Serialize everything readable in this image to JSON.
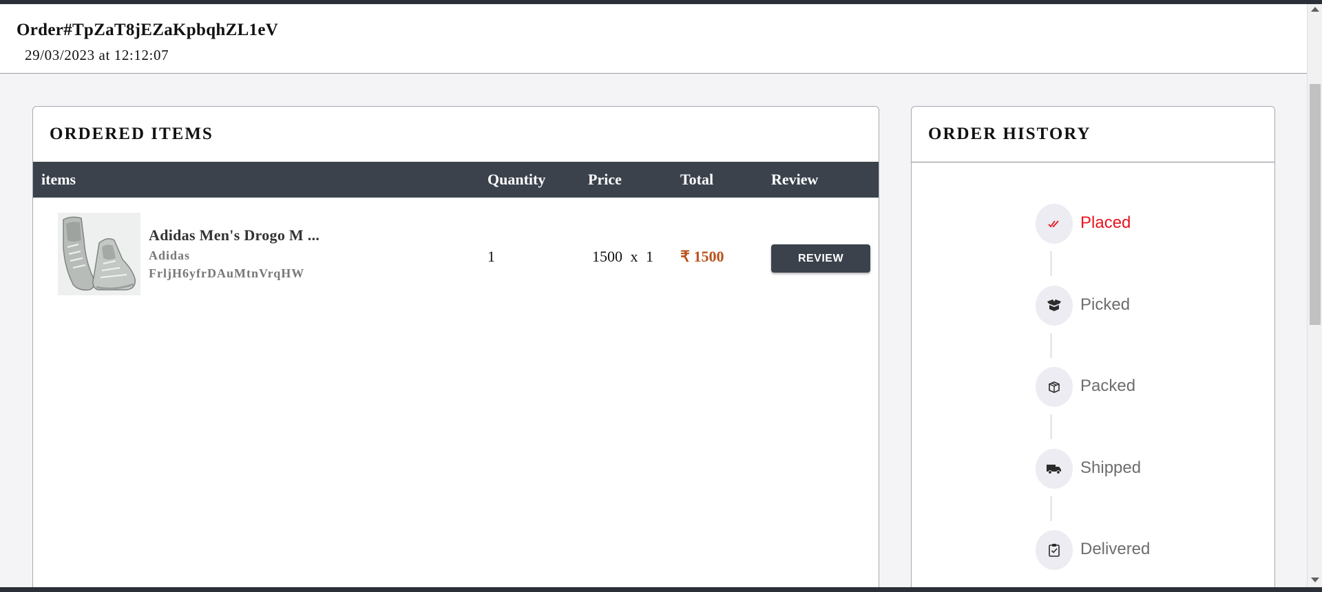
{
  "header": {
    "order_id": "Order#TpZaT8jEZaKpbqhZL1eV",
    "order_date": "29/03/2023 at 12:12:07"
  },
  "ordered_items": {
    "title": "ORDERED ITEMS",
    "columns": [
      "items",
      "Quantity",
      "Price",
      "Total",
      "Review"
    ],
    "rows": [
      {
        "image_icon": "sneaker-image",
        "name": "Adidas Men's Drogo M ...",
        "brand": "Adidas",
        "sku": "FrljH6yfrDAuMtnVrqHW",
        "quantity": "1",
        "price": "1500  x  1",
        "total": "₹ 1500",
        "review_label": "REVIEW"
      }
    ]
  },
  "order_history": {
    "title": "ORDER HISTORY",
    "steps": [
      {
        "label": "Placed",
        "icon": "double-check-icon",
        "active": true
      },
      {
        "label": "Picked",
        "icon": "open-box-icon",
        "active": false
      },
      {
        "label": "Packed",
        "icon": "package-icon",
        "active": false
      },
      {
        "label": "Shipped",
        "icon": "truck-icon",
        "active": false
      },
      {
        "label": "Delivered",
        "icon": "clipboard-check-icon",
        "active": false
      }
    ]
  },
  "colors": {
    "table_header": "#3b424c",
    "total_text": "#b8531b",
    "active_step": "#e8141f"
  }
}
